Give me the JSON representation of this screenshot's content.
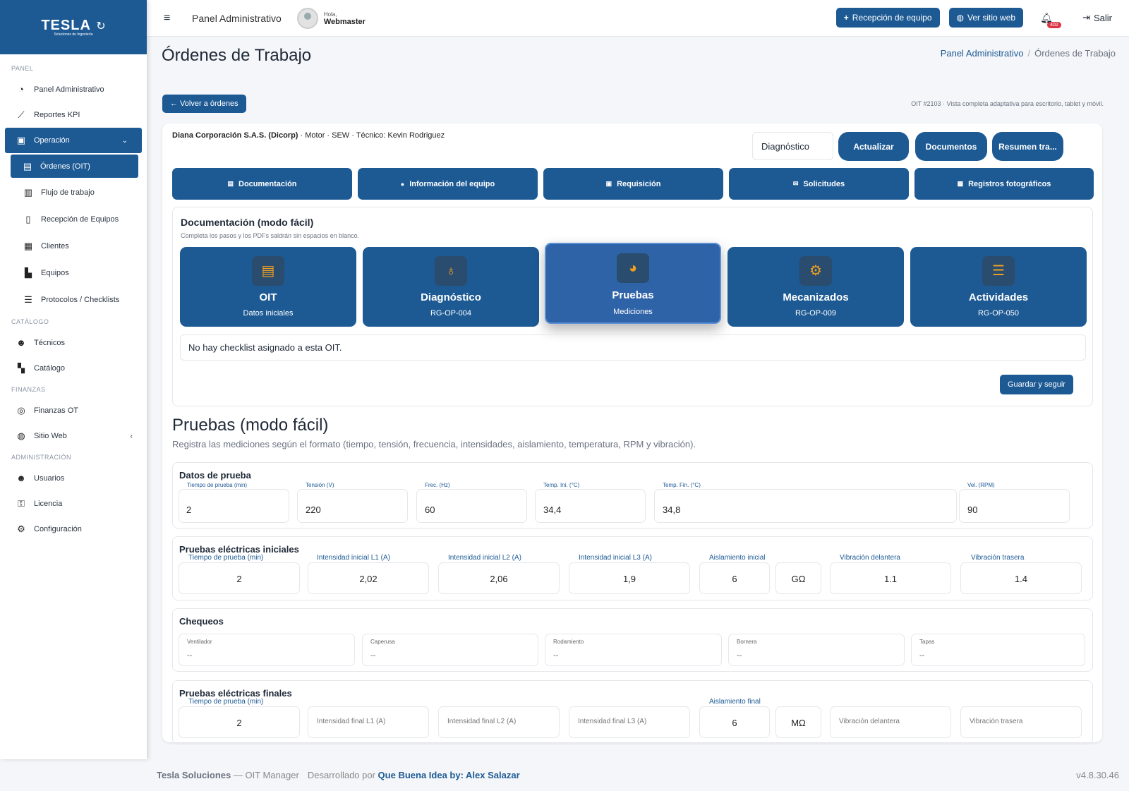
{
  "brand": {
    "logo": "TESLA",
    "logo_sub": "Soluciones de Ingeniería"
  },
  "sidebar": {
    "sections": [
      "PANEL",
      "CATÁLOGO",
      "FINANZAS",
      "ADMINISTRACIÓN"
    ],
    "items": [
      {
        "label": "Panel Administrativo",
        "icon": "chart-pie-icon"
      },
      {
        "label": "Reportes KPI",
        "icon": "chart-line-icon"
      },
      {
        "label": "Operación",
        "icon": "briefcase-icon"
      },
      {
        "label": "Órdenes (OIT)",
        "icon": "clipboard-icon"
      },
      {
        "label": "Flujo de trabajo",
        "icon": "columns-icon"
      },
      {
        "label": "Recepción de Equipos",
        "icon": "tablet-icon"
      },
      {
        "label": "Clientes",
        "icon": "building-icon"
      },
      {
        "label": "Equipos",
        "icon": "industry-icon"
      },
      {
        "label": "Protocolos / Checklists",
        "icon": "list-check-icon"
      },
      {
        "label": "Técnicos",
        "icon": "user-gear-icon"
      },
      {
        "label": "Catálogo",
        "icon": "boxes-icon"
      },
      {
        "label": "Finanzas OT",
        "icon": "coins-icon"
      },
      {
        "label": "Sitio Web",
        "icon": "globe-icon"
      },
      {
        "label": "Usuarios",
        "icon": "users-icon"
      },
      {
        "label": "Licencia",
        "icon": "key-icon"
      },
      {
        "label": "Configuración",
        "icon": "gear-icon"
      }
    ]
  },
  "topbar": {
    "title": "Panel Administrativo",
    "greeting": "Hola,",
    "user": "Webmaster",
    "btn_reception": "Recepción de equipo",
    "btn_site": "Ver sitio web",
    "notif_count": "402",
    "logout": "Salir"
  },
  "page": {
    "title": "Órdenes de Trabajo",
    "crumb_home": "Panel Administrativo",
    "crumb_sep": "/",
    "crumb_current": "Órdenes de Trabajo",
    "back": "← Volver a órdenes",
    "note": "OIT #2103 · Vista completa adaptativa para escritorio, tablet y móvil."
  },
  "order": {
    "client": "Diana Corporación S.A.S. (Dicorp)",
    "details": " · Motor · SEW · Técnico: Kevin Rodriguez",
    "status": "Diagnóstico",
    "actions": [
      "Actualizar",
      "Documentos",
      "Resumen tra..."
    ]
  },
  "tabs": [
    "Documentación",
    "Información del equipo",
    "Requisición",
    "Solicitudes",
    "Registros fotográficos"
  ],
  "doc": {
    "title": "Documentación (modo fácil)",
    "subtitle": "Completa los pasos y los PDFs saldrán sin espacios en blanco.",
    "steps": [
      {
        "name": "OIT",
        "code": "Datos iniciales",
        "icon": "clipboard-icon"
      },
      {
        "name": "Diagnóstico",
        "code": "RG-OP-004",
        "icon": "stethoscope-icon"
      },
      {
        "name": "Pruebas",
        "code": "Mediciones",
        "icon": "gauge-icon"
      },
      {
        "name": "Mecanizados",
        "code": "RG-OP-009",
        "icon": "cogs-icon"
      },
      {
        "name": "Actividades",
        "code": "RG-OP-050",
        "icon": "list-icon"
      }
    ],
    "no_checklist": "No hay checklist asignado a esta OIT.",
    "save": "Guardar y seguir"
  },
  "pruebas": {
    "title": "Pruebas (modo fácil)",
    "subtitle": "Registra las mediciones según el formato (tiempo, tensión, frecuencia, intensidades, aislamiento, temperatura, RPM y vibración).",
    "datos": {
      "title": "Datos de prueba",
      "fields": [
        {
          "label": "Tiempo de prueba (min)",
          "value": "2"
        },
        {
          "label": "Tensión (V)",
          "value": "220"
        },
        {
          "label": "Frec. (Hz)",
          "value": "60"
        },
        {
          "label": "Temp. Ini. (°C)",
          "value": "34,4"
        },
        {
          "label": "Temp. Fin. (°C)",
          "value": "34,8"
        },
        {
          "label": "Vel. (RPM)",
          "value": "90"
        }
      ]
    },
    "iniciales": {
      "title": "Pruebas eléctricas iniciales",
      "fields": [
        {
          "label": "Tiempo de prueba (min)",
          "value": "2"
        },
        {
          "label": "Intensidad inicial L1 (A)",
          "value": "2,02"
        },
        {
          "label": "Intensidad inicial L2 (A)",
          "value": "2,06"
        },
        {
          "label": "Intensidad inicial L3 (A)",
          "value": "1,9"
        },
        {
          "label": "Aislamiento inicial",
          "value": "6"
        },
        {
          "label": "",
          "value": "GΩ"
        },
        {
          "label": "Vibración delantera",
          "value": "1.1"
        },
        {
          "label": "Vibración trasera",
          "value": "1.4"
        }
      ]
    },
    "chequeos": {
      "title": "Chequeos",
      "fields": [
        {
          "label": "Ventilador",
          "value": "--"
        },
        {
          "label": "Caperusa",
          "value": "--"
        },
        {
          "label": "Rodamiento",
          "value": "--"
        },
        {
          "label": "Bornera",
          "value": "--"
        },
        {
          "label": "Tapas",
          "value": "--"
        }
      ]
    },
    "finales": {
      "title": "Pruebas eléctricas finales",
      "fields": [
        {
          "label": "Tiempo de prueba (min)",
          "value": "2"
        },
        {
          "label": "",
          "placeholder": "Intensidad final L1 (A)"
        },
        {
          "label": "",
          "placeholder": "Intensidad final L2 (A)"
        },
        {
          "label": "",
          "placeholder": "Intensidad final L3 (A)"
        },
        {
          "label": "Aislamiento final",
          "value": "6"
        },
        {
          "label": "",
          "value": "MΩ"
        },
        {
          "label": "",
          "placeholder": "Vibración delantera"
        },
        {
          "label": "",
          "placeholder": "Vibración trasera"
        }
      ]
    }
  },
  "footer": {
    "company": "Tesla Soluciones",
    "product": " — OIT Manager",
    "dev_prefix": "Desarrollado por ",
    "dev": "Que Buena Idea by: Alex Salazar",
    "version": "v4.8.30.46"
  },
  "colors": {
    "primary": "#1d5a94",
    "accent_icon": "#f0a020",
    "badge": "#dc3545"
  }
}
